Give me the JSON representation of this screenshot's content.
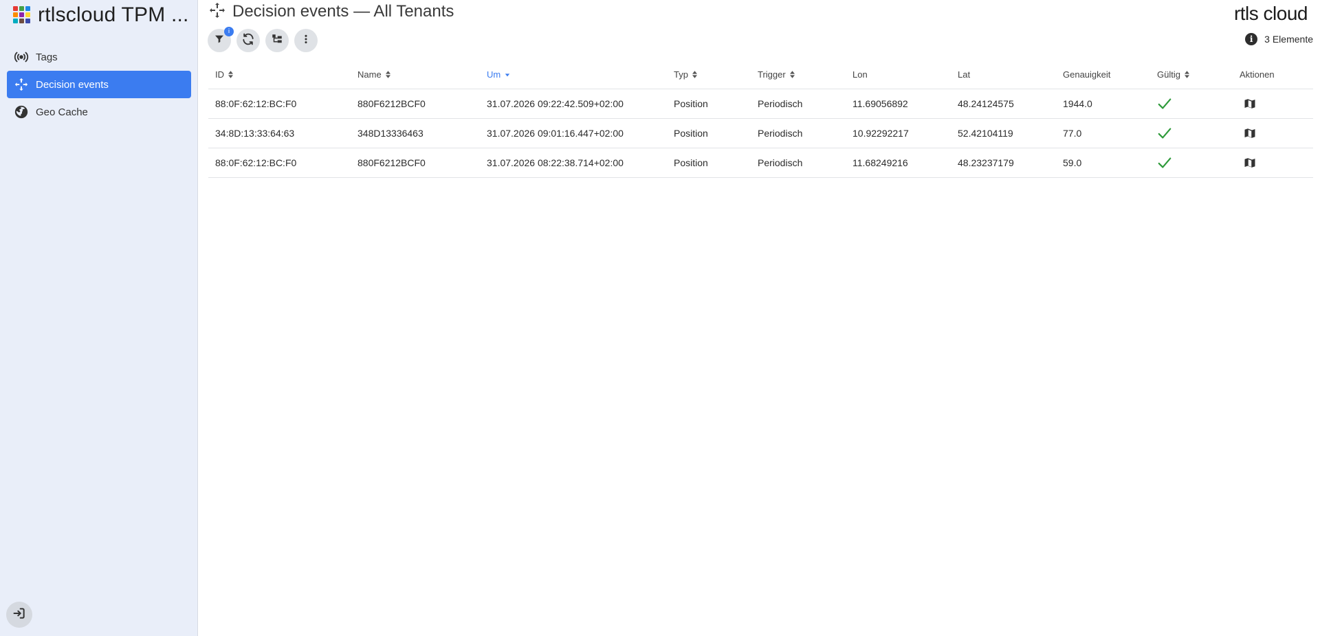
{
  "app": {
    "title": "rtlscloud TPM ...",
    "logo_colors": [
      "#e53935",
      "#43a047",
      "#1e88e5",
      "#fb8c00",
      "#8e24aa",
      "#fdd835",
      "#00acc1",
      "#6d4c41",
      "#3949ab"
    ],
    "accent": "#3b7cf0",
    "brand_right": "rtls cloud"
  },
  "sidebar": {
    "items": [
      {
        "label": "Tags",
        "icon": "broadcast-icon",
        "active": false
      },
      {
        "label": "Decision events",
        "icon": "move-arrows-icon",
        "active": true
      },
      {
        "label": "Geo Cache",
        "icon": "globe-icon",
        "active": false
      }
    ],
    "logout_icon": "sign-in-icon"
  },
  "header": {
    "title": "Decision events — All Tenants",
    "icon": "move-arrows-icon"
  },
  "toolbar": {
    "filter_badge": "i",
    "buttons": [
      "filter-icon",
      "refresh-icon",
      "tree-view-icon",
      "more-vertical-icon"
    ]
  },
  "summary": {
    "count_label": "3 Elemente",
    "icon": "info-icon"
  },
  "table": {
    "columns": [
      {
        "label": "ID",
        "sortable": true,
        "sorted": false
      },
      {
        "label": "Name",
        "sortable": true,
        "sorted": false
      },
      {
        "label": "Um",
        "sortable": true,
        "sorted": true,
        "direction": "desc"
      },
      {
        "label": "Typ",
        "sortable": true,
        "sorted": false
      },
      {
        "label": "Trigger",
        "sortable": true,
        "sorted": false
      },
      {
        "label": "Lon",
        "sortable": false,
        "sorted": false
      },
      {
        "label": "Lat",
        "sortable": false,
        "sorted": false
      },
      {
        "label": "Genauigkeit",
        "sortable": false,
        "sorted": false
      },
      {
        "label": "Gültig",
        "sortable": true,
        "sorted": false
      },
      {
        "label": "Aktionen",
        "sortable": false,
        "sorted": false
      }
    ],
    "rows": [
      {
        "id": "88:0F:62:12:BC:F0",
        "name": "880F6212BCF0",
        "um": "31.07.2026 09:22:42.509+02:00",
        "typ": "Position",
        "trigger": "Periodisch",
        "lon": "11.69056892",
        "lat": "48.24124575",
        "genauigkeit": "1944.0",
        "gueltig": true,
        "action": "map-icon"
      },
      {
        "id": "34:8D:13:33:64:63",
        "name": "348D13336463",
        "um": "31.07.2026 09:01:16.447+02:00",
        "typ": "Position",
        "trigger": "Periodisch",
        "lon": "10.92292217",
        "lat": "52.42104119",
        "genauigkeit": "77.0",
        "gueltig": true,
        "action": "map-icon"
      },
      {
        "id": "88:0F:62:12:BC:F0",
        "name": "880F6212BCF0",
        "um": "31.07.2026 08:22:38.714+02:00",
        "typ": "Position",
        "trigger": "Periodisch",
        "lon": "11.68249216",
        "lat": "48.23237179",
        "genauigkeit": "59.0",
        "gueltig": true,
        "action": "map-icon"
      }
    ],
    "check_color": "#2e9a3a"
  }
}
